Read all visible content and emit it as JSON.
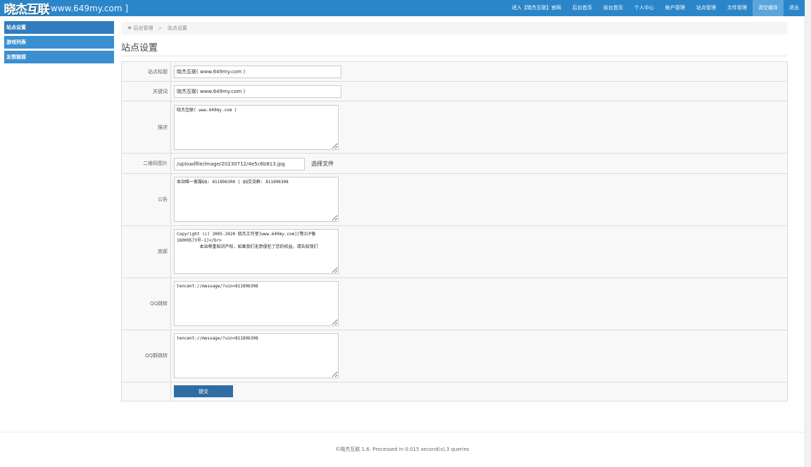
{
  "header": {
    "logo_text": "晓杰互联",
    "url_text": "www.649my.com ]",
    "nav": [
      {
        "label": "进入【晓杰互联】官网",
        "active": false
      },
      {
        "label": "后台首页",
        "active": false
      },
      {
        "label": "前台首页",
        "active": false
      },
      {
        "label": "个人中心",
        "active": false
      },
      {
        "label": "帐户管理",
        "active": false
      },
      {
        "label": "站点管理",
        "active": false
      },
      {
        "label": "文件管理",
        "active": false
      },
      {
        "label": "清空缓存",
        "active": true
      },
      {
        "label": "退出",
        "active": false
      }
    ]
  },
  "sidebar": {
    "items": [
      {
        "label": "站点设置"
      },
      {
        "label": "游戏列表"
      },
      {
        "label": "友情链接"
      }
    ]
  },
  "breadcrumb": {
    "home": "后台管理",
    "separator": ">",
    "current": "站点设置"
  },
  "page_title": "站点设置",
  "form": {
    "site_title": {
      "label": "站点标题",
      "value": "晓杰互联( www.649my.com )"
    },
    "keywords": {
      "label": "关键词",
      "value": "晓杰互联( www.649my.com )"
    },
    "description": {
      "label": "描述",
      "value": "晓杰互联( www.649my.com )"
    },
    "qrcode": {
      "label": "二维码图片",
      "value": "/uploadfile/image/20230712/4e5c6b813.jpg",
      "button": "选择文件"
    },
    "notice": {
      "label": "公告",
      "value": "本站唯一客服QQ: 811896308 | QQ交流群: 811896308"
    },
    "footer_html": {
      "label": "底部",
      "value": "Copyright (c) 2005-2020 晓杰工作室[www.649my.com][鄂ICP备16009573号-1]</br>\n         本站尊重知识产权，如果我们无意侵犯了您的权益，请告知我们"
    },
    "qq_link": {
      "label": "QQ跳转",
      "value": "tencent://message/?uin=811896308"
    },
    "qq_group_link": {
      "label": "QQ群跳转",
      "value": "tencent://message/?uin=811896308"
    },
    "submit": "提交"
  },
  "footer": {
    "text": "©晓杰互联 1.6. Processed in 0.015 second(s),3 queries"
  }
}
